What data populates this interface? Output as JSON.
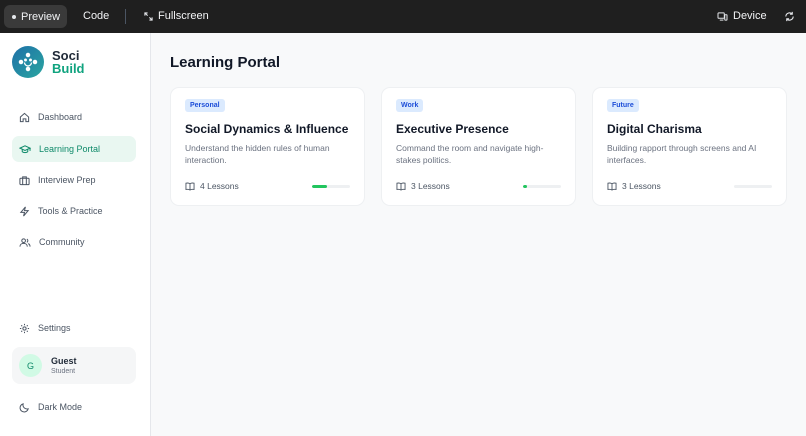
{
  "topbar": {
    "preview_label": "Preview",
    "code_label": "Code",
    "fullscreen_label": "Fullscreen",
    "device_label": "Device"
  },
  "brand": {
    "line1": "Soci",
    "line2": "Build"
  },
  "sidebar": {
    "items": [
      {
        "label": "Dashboard",
        "icon": "home-icon"
      },
      {
        "label": "Learning Portal",
        "icon": "graduation-cap-icon",
        "active": true
      },
      {
        "label": "Interview Prep",
        "icon": "briefcase-icon"
      },
      {
        "label": "Tools & Practice",
        "icon": "lightning-icon"
      },
      {
        "label": "Community",
        "icon": "users-icon"
      }
    ],
    "settings_label": "Settings",
    "darkmode_label": "Dark Mode"
  },
  "user": {
    "initial": "G",
    "name": "Guest",
    "role": "Student"
  },
  "main": {
    "title": "Learning Portal",
    "cards": [
      {
        "tag": "Personal",
        "title": "Social Dynamics & Influence",
        "desc": "Understand the hidden rules of human interaction.",
        "lessons": "4 Lessons",
        "progress": 0.4
      },
      {
        "tag": "Work",
        "title": "Executive Presence",
        "desc": "Command the room and navigate high-stakes politics.",
        "lessons": "3 Lessons",
        "progress": 0.1
      },
      {
        "tag": "Future",
        "title": "Digital Charisma",
        "desc": "Building rapport through screens and AI interfaces.",
        "lessons": "3 Lessons",
        "progress": 0
      }
    ]
  },
  "colors": {
    "accent": "#10a37f",
    "progress": "#22c55e",
    "tag_bg": "#dbeafe",
    "tag_text": "#1d4ed8"
  }
}
